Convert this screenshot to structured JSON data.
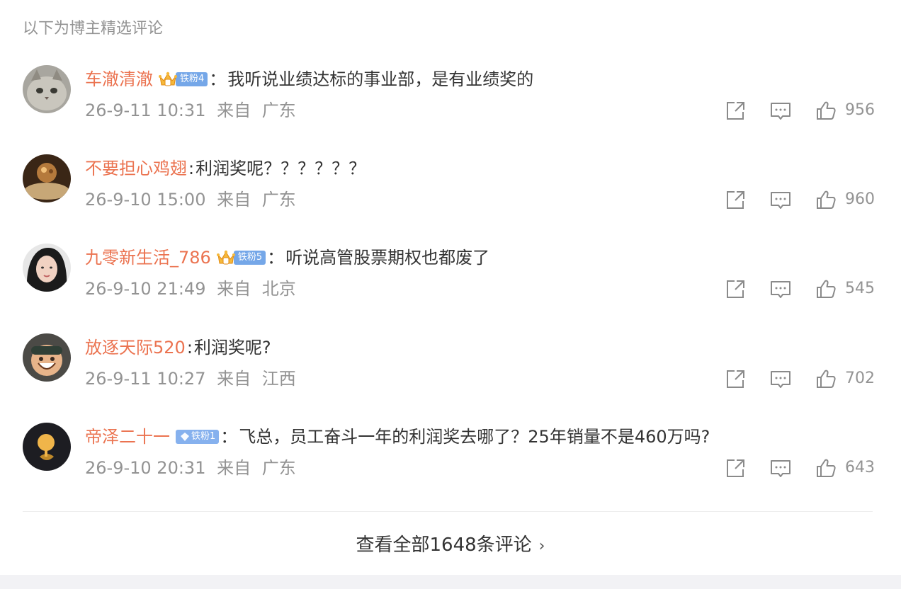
{
  "section_title": "以下为博主精选评论",
  "comments": [
    {
      "username": "车澈清澈",
      "badge": "铁粉4",
      "badge_type": "crown",
      "text": "我听说业绩达标的事业部，是有业绩奖的",
      "time": "26-9-11 10:31",
      "from": "来自",
      "location": "广东",
      "likes": "956",
      "avatar_color": "#9a9a96"
    },
    {
      "username": "不要担心鸡翅",
      "badge": "",
      "badge_type": "none",
      "text": "利润奖呢？？？？？？",
      "time": "26-9-10 15:00",
      "from": "来自",
      "location": "广东",
      "likes": "960",
      "avatar_color": "#6b4a2a"
    },
    {
      "username": "九零新生活_786",
      "badge": "铁粉5",
      "badge_type": "crown",
      "text": "听说高管股票期权也都废了",
      "time": "26-9-10 21:49",
      "from": "来自",
      "location": "北京",
      "likes": "545",
      "avatar_color": "#2b2b2b"
    },
    {
      "username": "放逐天际520",
      "badge": "",
      "badge_type": "none",
      "text": "利润奖呢?",
      "time": "26-9-11 10:27",
      "from": "来自",
      "location": "江西",
      "likes": "702",
      "avatar_color": "#5a4a3a"
    },
    {
      "username": "帝泽二十一",
      "badge": "铁粉1",
      "badge_type": "diamond",
      "text": "飞总，员工奋斗一年的利润奖去哪了？25年销量不是460万吗?",
      "time": "26-9-10 20:31",
      "from": "来自",
      "location": "广东",
      "likes": "643",
      "avatar_color": "#1f1f24"
    }
  ],
  "view_all_label": "查看全部1648条评论",
  "view_all_chevron": "›",
  "colors": {
    "username": "#eb7350",
    "meta": "#939393",
    "text": "#333333",
    "badge": "#75a7e8"
  }
}
